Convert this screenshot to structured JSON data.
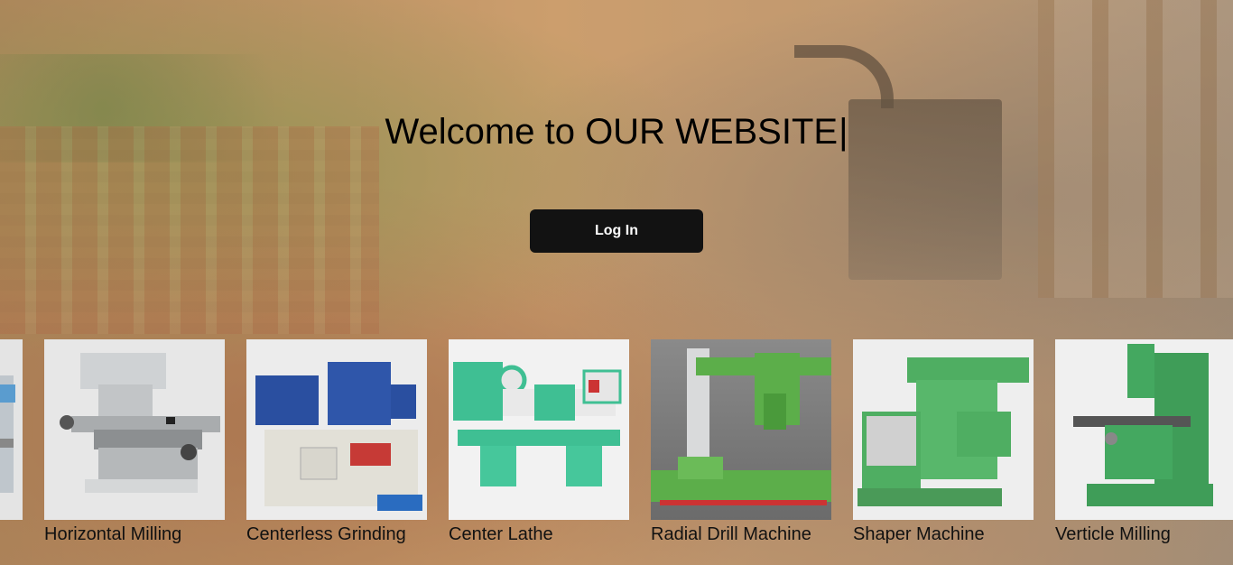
{
  "hero": {
    "headline": "Welcome to OUR WEBSITE",
    "cursor": "|",
    "login_label": "Log In"
  },
  "machines": [
    {
      "label": "",
      "icon": "machine-image",
      "color": "#3a86c8"
    },
    {
      "label": "Horizontal Milling",
      "icon": "milling-machine-image",
      "color": "#c9c9c9"
    },
    {
      "label": "Centerless Grinding",
      "icon": "grinding-machine-image",
      "color": "#2a4fa0"
    },
    {
      "label": "Center Lathe",
      "icon": "lathe-machine-image",
      "color": "#3fbf93"
    },
    {
      "label": "Radial Drill Machine",
      "icon": "drill-machine-image",
      "color": "#5cae4a"
    },
    {
      "label": "Shaper Machine",
      "icon": "shaper-machine-image",
      "color": "#4fae62"
    },
    {
      "label": "Verticle Milling",
      "icon": "vertical-milling-machine-image",
      "color": "#44a860"
    }
  ]
}
